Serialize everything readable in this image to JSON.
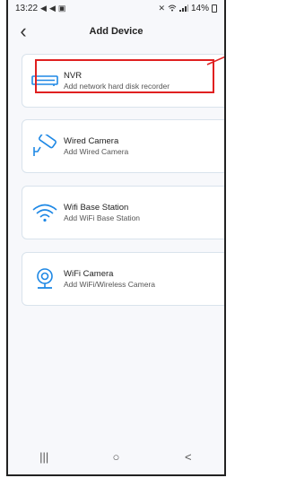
{
  "status_bar": {
    "time": "13:22",
    "left_icons": [
      "send-icon",
      "send-icon",
      "gallery-icon"
    ],
    "right_text": "14%",
    "right_icons": [
      "mute-icon",
      "wifi-icon",
      "signal-icon",
      "battery-icon"
    ]
  },
  "header": {
    "title": "Add Device",
    "back_icon": "back-chevron-icon"
  },
  "devices": [
    {
      "name": "NVR",
      "desc": "Add network hard disk recorder",
      "icon": "nvr-icon"
    },
    {
      "name": "Wired Camera",
      "desc": "Add Wired Camera",
      "icon": "wired-camera-icon"
    },
    {
      "name": "Wifi Base Station",
      "desc": "Add WiFi Base Station",
      "icon": "wifi-icon"
    },
    {
      "name": "WiFi Camera",
      "desc": "Add WiFi/Wireless Camera",
      "icon": "wifi-camera-icon"
    }
  ],
  "annotation": {
    "color": "#e02020",
    "target": "NVR"
  },
  "nav": {
    "recent_glyph": "|||",
    "home_glyph": "○",
    "back_glyph": "<"
  },
  "colors": {
    "accent": "#1e88e5",
    "card_border": "#d9e3ec",
    "background": "#f7f8fb"
  }
}
